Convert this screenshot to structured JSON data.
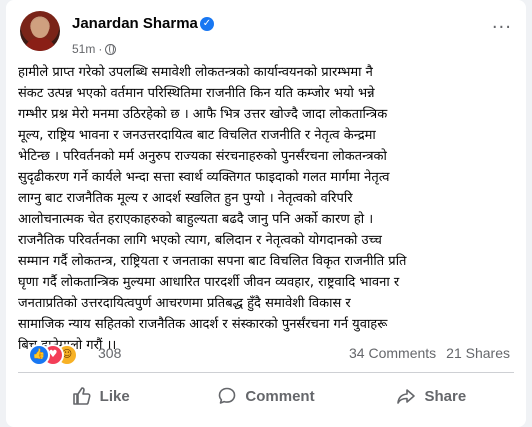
{
  "post": {
    "author": "Janardan Sharma",
    "time": "51m",
    "separator": "·",
    "more_glyph": "···",
    "verified_glyph": "✓",
    "body": "हामीले प्राप्त गरेको उपलब्धि समावेशी लोकतन्त्रको कार्यान्वयनको प्रारम्भमा नै\nसंकट उत्पन्न भएको वर्तमान परिस्थितिमा राजनीति किन यति कम्जोर भयो भन्ने\nगम्भीर प्रश्न मेरो मनमा उठिरहेको छ । आफै भित्र उत्तर खोज्दै जादा लोकतान्त्रिक\nमूल्य, राष्ट्रिय भावना र जनउत्तरदायित्व बाट विचलित राजनीति र नेतृत्व केन्द्रमा\nभेटिन्छ । परिवर्तनको मर्म अनुरुप राज्यका संरचनाहरुको पुनर्संरचना लोकतन्त्रको\nसुदृढीकरण गर्ने कार्यले भन्दा सत्ता स्वार्थ व्यक्तिगत फाइदाको गलत मार्गमा नेतृत्व\nलाग्नु बाट राजनैतिक मूल्य र आदर्श स्खलित हुन पुग्यो । नेतृत्वको वरिपरि\nआलोचनात्मक चेत हराएकाहरुको बाहुल्यता बढदै जानु पनि अर्को कारण हो ।\nराजनैतिक परिवर्तनका लागि भएको त्याग, बलिदान र नेतृत्वको योगदानको उच्च\nसम्मान गर्दै लोकतन्त्र, राष्ट्रियता र जनताका सपना बाट विचलित विकृत राजनीति प्रति\nघृणा गर्दै लोकतान्त्रिक मुल्यमा आधारित पारदर्शी जीवन व्यवहार, राष्ट्रवादि भावना र\nजनताप्रतिको उत्तरदायित्वपुर्ण आचरणमा प्रतिबद्ध हुँदै समावेशी विकास र\nसामाजिक न्याय सहितको राजनैतिक आदर्श र  संस्कारको पुनर्संरचना गर्न युवाहरू\nबिच हातेमालो गरौं ।।"
  },
  "reactions": {
    "count": "308",
    "types": [
      "like",
      "love",
      "haha"
    ],
    "like_glyph": "👍",
    "love_glyph": "♥",
    "haha_glyph": "☺"
  },
  "stats": {
    "comments": "34 Comments",
    "shares": "21 Shares"
  },
  "actions": {
    "like_label": "Like",
    "comment_label": "Comment",
    "share_label": "Share"
  },
  "colors": {
    "brand": "#1877f2",
    "love": "#f33e58",
    "haha": "#f7b125",
    "secondary_text": "#65676b"
  }
}
